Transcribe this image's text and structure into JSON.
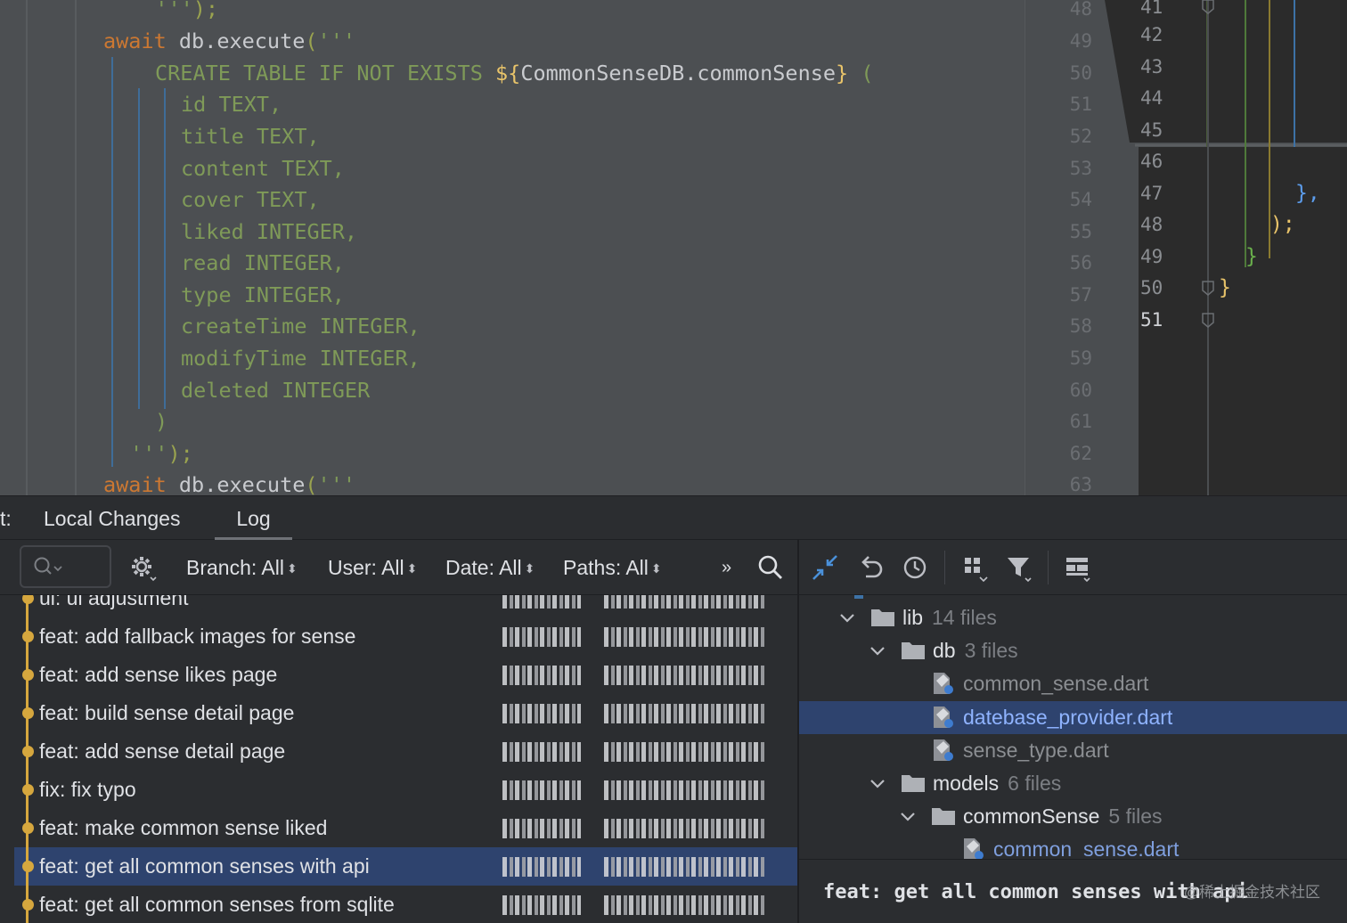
{
  "editor": {
    "lines": [
      {
        "segments": [
          {
            "t": "  ",
            "c": "id"
          },
          {
            "t": "'''",
            "c": "str"
          },
          {
            "t": ");",
            "c": "par"
          }
        ]
      },
      {
        "segments": [
          {
            "t": "await",
            "c": "kw"
          },
          {
            "t": " db.execute",
            "c": "id"
          },
          {
            "t": "(",
            "c": "par"
          },
          {
            "t": "'''",
            "c": "str"
          }
        ]
      },
      {
        "segments": [
          {
            "t": "CREATE TABLE IF NOT EXISTS ",
            "c": "str"
          },
          {
            "t": "${",
            "c": "interp"
          },
          {
            "t": "CommonSenseDB.commonSense",
            "c": "ent"
          },
          {
            "t": "}",
            "c": "interp"
          },
          {
            "t": " (",
            "c": "str"
          }
        ]
      },
      {
        "segments": [
          {
            "t": "id TEXT,",
            "c": "str"
          }
        ]
      },
      {
        "segments": [
          {
            "t": "title TEXT,",
            "c": "str"
          }
        ]
      },
      {
        "segments": [
          {
            "t": "content TEXT,",
            "c": "str"
          }
        ]
      },
      {
        "segments": [
          {
            "t": "cover TEXT,",
            "c": "str"
          }
        ]
      },
      {
        "segments": [
          {
            "t": "liked INTEGER,",
            "c": "str"
          }
        ]
      },
      {
        "segments": [
          {
            "t": "read INTEGER,",
            "c": "str"
          }
        ]
      },
      {
        "segments": [
          {
            "t": "type INTEGER,",
            "c": "str"
          }
        ]
      },
      {
        "segments": [
          {
            "t": "createTime INTEGER,",
            "c": "str"
          }
        ]
      },
      {
        "segments": [
          {
            "t": "modifyTime INTEGER,",
            "c": "str"
          }
        ]
      },
      {
        "segments": [
          {
            "t": "deleted INTEGER",
            "c": "str"
          }
        ]
      },
      {
        "segments": [
          {
            "t": ")",
            "c": "str"
          }
        ]
      },
      {
        "segments": [
          {
            "t": "'''",
            "c": "str"
          },
          {
            "t": ");",
            "c": "par"
          }
        ]
      },
      {
        "segments": [
          {
            "t": "await",
            "c": "kw"
          },
          {
            "t": " db.execute",
            "c": "id"
          },
          {
            "t": "(",
            "c": "par"
          },
          {
            "t": "'''",
            "c": "str"
          }
        ]
      }
    ],
    "line_numbers": [
      "48",
      "49",
      "50",
      "51",
      "52",
      "53",
      "54",
      "55",
      "56",
      "57",
      "58",
      "59",
      "60",
      "61",
      "62",
      "63"
    ]
  },
  "compare": {
    "line_numbers": [
      "41",
      "42",
      "43",
      "44",
      "45",
      "46",
      "47",
      "48",
      "49",
      "50",
      "51"
    ],
    "current_line": "51",
    "code": [
      {
        "row": 6,
        "text": "},",
        "color": "#5c9ded"
      },
      {
        "row": 7,
        "text": ");",
        "color": "#e9c46a"
      },
      {
        "row": 8,
        "text": "}",
        "color": "#6ab04c"
      },
      {
        "row": 9,
        "text": "}",
        "color": "#e9c46a"
      }
    ]
  },
  "tabs": {
    "left_cut": "t:",
    "local_changes": "Local Changes",
    "log": "Log"
  },
  "toolbar": {
    "branch": "Branch: All",
    "user": "User: All",
    "date": "Date: All",
    "paths": "Paths: All",
    "more": "»"
  },
  "commits": [
    {
      "message": "ui: ui adjustment",
      "selected": false
    },
    {
      "message": "feat: add fallback images for sense",
      "selected": false
    },
    {
      "message": "feat: add sense likes page",
      "selected": false
    },
    {
      "message": "feat: build sense detail page",
      "selected": false
    },
    {
      "message": "feat: add sense detail page",
      "selected": false
    },
    {
      "message": "fix: fix typo",
      "selected": false
    },
    {
      "message": "feat: make common sense liked",
      "selected": false
    },
    {
      "message": "feat: get all common senses with api",
      "selected": true
    },
    {
      "message": "feat: get all common senses from sqlite",
      "selected": false
    }
  ],
  "tree": [
    {
      "depth": 0,
      "kind": "folder",
      "name": "lib",
      "count": "14 files"
    },
    {
      "depth": 1,
      "kind": "folder",
      "name": "db",
      "count": "3 files"
    },
    {
      "depth": 2,
      "kind": "file",
      "name": "common_sense.dart",
      "status": "unchanged",
      "selected": false
    },
    {
      "depth": 2,
      "kind": "file",
      "name": "datebase_provider.dart",
      "status": "modified",
      "selected": true
    },
    {
      "depth": 2,
      "kind": "file",
      "name": "sense_type.dart",
      "status": "unchanged",
      "selected": false
    },
    {
      "depth": 1,
      "kind": "folder",
      "name": "models",
      "count": "6 files"
    },
    {
      "depth": 2,
      "kind": "folder",
      "name": "commonSense",
      "count": "5 files"
    },
    {
      "depth": 3,
      "kind": "file",
      "name": "common_sense.dart",
      "status": "modified",
      "selected": false
    }
  ],
  "details": {
    "title": "feat: get all common senses with api",
    "watermark": "@稀土掘金技术社区"
  },
  "colors": {
    "keyword": "#cc7832",
    "string": "#7f9a58",
    "selection": "#2e436e",
    "graph": "#d6a73e",
    "modified_file": "#7f9fde"
  }
}
